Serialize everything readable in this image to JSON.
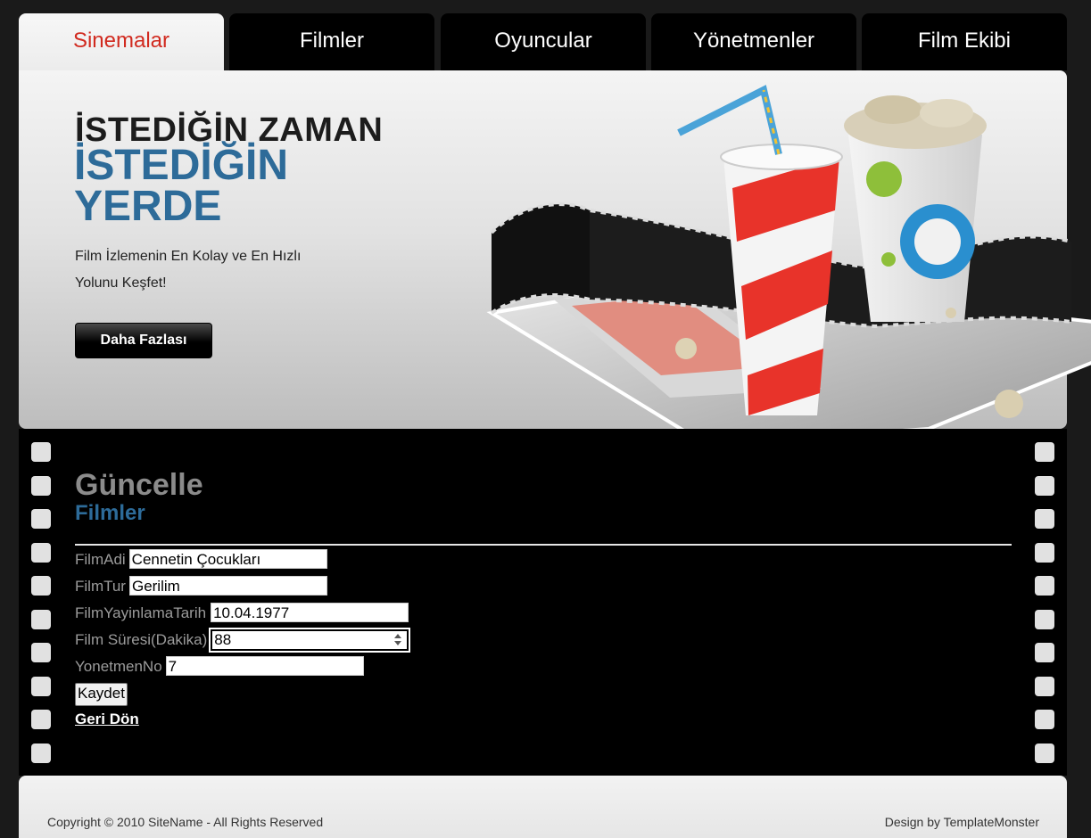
{
  "nav": {
    "tabs": [
      "Sinemalar",
      "Filmler",
      "Oyuncular",
      "Yönetmenler",
      "Film Ekibi"
    ],
    "active_tab": "Sinemalar"
  },
  "hero": {
    "headline": "İSTEDİĞİN ZAMAN",
    "headline_accent": "İSTEDİĞİN YERDE",
    "subtitle": "Film İzlemenin En Kolay ve En Hızlı Yolunu Keşfet!",
    "button_label": "Daha Fazlası"
  },
  "page": {
    "title": "Güncelle",
    "subtitle": "Filmler"
  },
  "form": {
    "fields": [
      {
        "label": "FilmAdi",
        "value": "Cennetin Çocukları"
      },
      {
        "label": "FilmTur",
        "value": "Gerilim"
      },
      {
        "label": "FilmYayinlamaTarih",
        "value": "10.04.1977"
      },
      {
        "label": "Film Süresi(Dakika)",
        "value": "88"
      },
      {
        "label": "YonetmenNo",
        "value": "7"
      }
    ],
    "submit_label": "Kaydet",
    "back_link": "Geri Dön"
  },
  "footer": {
    "copyright": "Copyright © 2010 SiteName - All Rights Reserved",
    "design_credit": "Design by TemplateMonster"
  },
  "colors": {
    "accent_blue": "#2d6b99",
    "accent_red": "#d12a1f",
    "background": "#1a1a1a"
  }
}
